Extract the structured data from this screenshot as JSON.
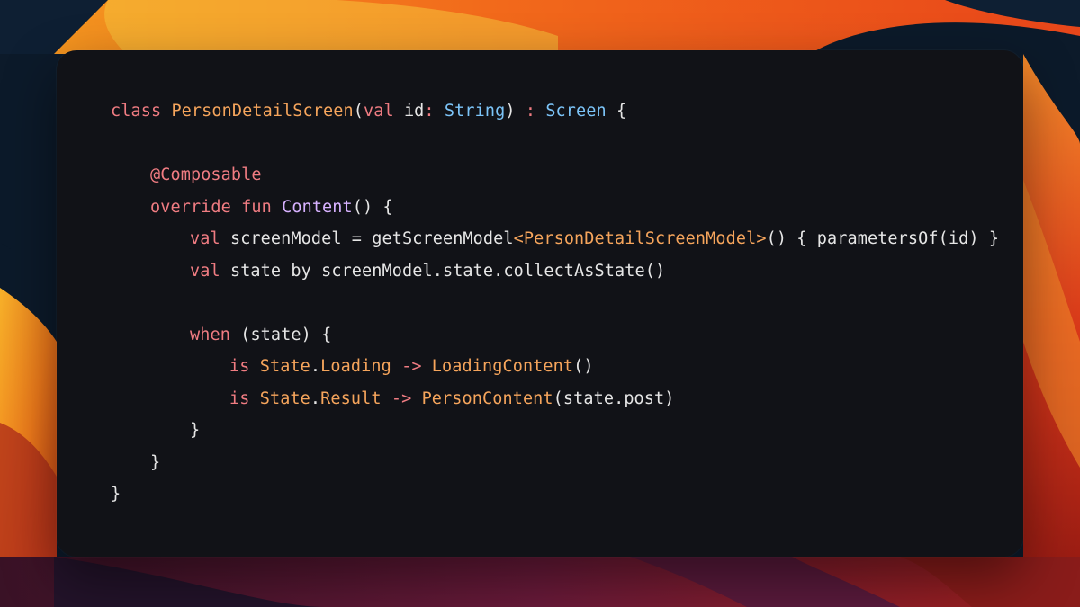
{
  "colors": {
    "window_bg": "#111217",
    "wallpaper_dark": "#0c1a2a",
    "wallpaper_orange": "#f26a1b",
    "wallpaper_yellow": "#f7b12a",
    "wallpaper_red": "#b31e17",
    "wallpaper_purple": "#4a1530",
    "keyword": "#f07c82",
    "class_name": "#f6a55c",
    "type": "#7cc4f8",
    "function": "#d7b1ff",
    "plain": "#e6e6e6"
  },
  "code": {
    "language": "kotlin",
    "lines": [
      {
        "indent": 0,
        "tokens": [
          {
            "text": "class ",
            "kind": "keyword"
          },
          {
            "text": "PersonDetailScreen",
            "kind": "class"
          },
          {
            "text": "(",
            "kind": "plain"
          },
          {
            "text": "val ",
            "kind": "keyword"
          },
          {
            "text": "id",
            "kind": "plain"
          },
          {
            "text": ": ",
            "kind": "operator"
          },
          {
            "text": "String",
            "kind": "type"
          },
          {
            "text": ") ",
            "kind": "plain"
          },
          {
            "text": ": ",
            "kind": "operator"
          },
          {
            "text": "Screen",
            "kind": "type"
          },
          {
            "text": " {",
            "kind": "plain"
          }
        ]
      },
      {
        "indent": 0,
        "tokens": []
      },
      {
        "indent": 1,
        "tokens": [
          {
            "text": "@Composable",
            "kind": "annotation"
          }
        ]
      },
      {
        "indent": 1,
        "tokens": [
          {
            "text": "override ",
            "kind": "keyword"
          },
          {
            "text": "fun ",
            "kind": "keyword"
          },
          {
            "text": "Content",
            "kind": "func"
          },
          {
            "text": "() {",
            "kind": "plain"
          }
        ]
      },
      {
        "indent": 2,
        "tokens": [
          {
            "text": "val ",
            "kind": "keyword"
          },
          {
            "text": "screenModel = getScreenModel",
            "kind": "plain"
          },
          {
            "text": "<PersonDetailScreenModel>",
            "kind": "generic"
          },
          {
            "text": "() { parametersOf(id) }",
            "kind": "plain"
          }
        ]
      },
      {
        "indent": 2,
        "tokens": [
          {
            "text": "val ",
            "kind": "keyword"
          },
          {
            "text": "state by screenModel.state.collectAsState()",
            "kind": "plain"
          }
        ]
      },
      {
        "indent": 0,
        "tokens": []
      },
      {
        "indent": 2,
        "tokens": [
          {
            "text": "when ",
            "kind": "keyword"
          },
          {
            "text": "(state) {",
            "kind": "plain"
          }
        ]
      },
      {
        "indent": 3,
        "tokens": [
          {
            "text": "is ",
            "kind": "keyword"
          },
          {
            "text": "State",
            "kind": "class"
          },
          {
            "text": ".",
            "kind": "plain"
          },
          {
            "text": "Loading",
            "kind": "class"
          },
          {
            "text": " -> ",
            "kind": "operator"
          },
          {
            "text": "LoadingContent",
            "kind": "class"
          },
          {
            "text": "()",
            "kind": "plain"
          }
        ]
      },
      {
        "indent": 3,
        "tokens": [
          {
            "text": "is ",
            "kind": "keyword"
          },
          {
            "text": "State",
            "kind": "class"
          },
          {
            "text": ".",
            "kind": "plain"
          },
          {
            "text": "Result",
            "kind": "class"
          },
          {
            "text": " -> ",
            "kind": "operator"
          },
          {
            "text": "PersonContent",
            "kind": "class"
          },
          {
            "text": "(state.post)",
            "kind": "plain"
          }
        ]
      },
      {
        "indent": 2,
        "tokens": [
          {
            "text": "}",
            "kind": "plain"
          }
        ]
      },
      {
        "indent": 1,
        "tokens": [
          {
            "text": "}",
            "kind": "plain"
          }
        ]
      },
      {
        "indent": 0,
        "tokens": [
          {
            "text": "}",
            "kind": "plain"
          }
        ]
      }
    ]
  }
}
